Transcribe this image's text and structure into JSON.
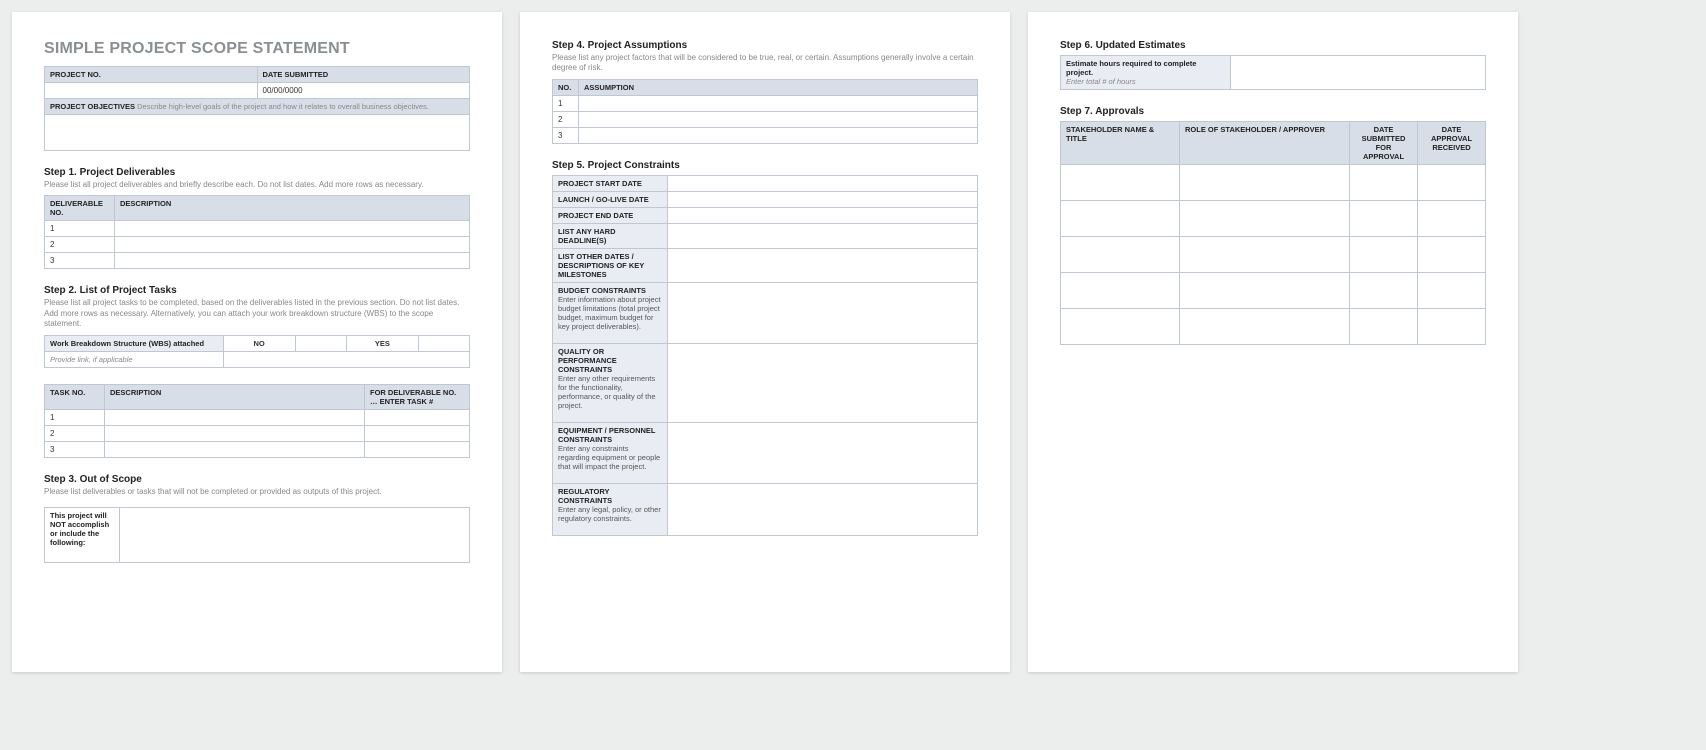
{
  "doc_title": "SIMPLE PROJECT SCOPE STATEMENT",
  "header_table": {
    "project_no_label": "PROJECT NO.",
    "date_submitted_label": "DATE SUBMITTED",
    "project_no_value": "",
    "date_submitted_value": "00/00/0000",
    "objectives_label": "PROJECT OBJECTIVES",
    "objectives_hint": "Describe high-level goals of the project and how it relates to overall business objectives.",
    "objectives_value": ""
  },
  "step1": {
    "title": "Step 1. Project Deliverables",
    "desc": "Please list all project deliverables and briefly describe each. Do not list dates. Add more rows as necessary.",
    "col_no": "DELIVERABLE NO.",
    "col_desc": "DESCRIPTION",
    "rows": [
      "1",
      "2",
      "3"
    ]
  },
  "step2": {
    "title": "Step 2. List of Project Tasks",
    "desc": "Please list all project tasks to be completed, based on the deliverables listed in the previous section. Do not list dates. Add more rows as necessary. Alternatively, you can attach your work breakdown structure (WBS) to the scope statement.",
    "wbs_label": "Work Breakdown Structure (WBS) attached",
    "no_label": "NO",
    "yes_label": "YES",
    "link_hint": "Provide link, if applicable",
    "col_task": "TASK NO.",
    "col_desc": "DESCRIPTION",
    "col_for": "FOR DELIVERABLE NO. … ENTER TASK #",
    "rows": [
      "1",
      "2",
      "3"
    ]
  },
  "step3": {
    "title": "Step 3. Out of Scope",
    "desc": "Please list deliverables or tasks that will not be completed or provided as outputs of this project.",
    "label_prefix": "This project ",
    "label_bold": "will NOT accomplish or include",
    "label_suffix": " the following:"
  },
  "step4": {
    "title": "Step 4. Project Assumptions",
    "desc": "Please list any project factors that will be considered to be true, real, or certain. Assumptions generally involve a certain degree of risk.",
    "col_no": "NO.",
    "col_assumption": "ASSUMPTION",
    "rows": [
      "1",
      "2",
      "3"
    ]
  },
  "step5": {
    "title": "Step 5. Project Constraints",
    "rows": [
      {
        "label": "PROJECT START DATE",
        "hint": ""
      },
      {
        "label": "LAUNCH / GO-LIVE DATE",
        "hint": ""
      },
      {
        "label": "PROJECT END DATE",
        "hint": ""
      },
      {
        "label": "LIST ANY HARD DEADLINE(S)",
        "hint": ""
      },
      {
        "label": "LIST OTHER DATES / DESCRIPTIONS OF KEY MILESTONES",
        "hint": ""
      },
      {
        "label": "BUDGET CONSTRAINTS",
        "hint": "Enter information about project budget limitations (total project budget, maximum budget for key project deliverables)."
      },
      {
        "label": "QUALITY OR PERFORMANCE CONSTRAINTS",
        "hint": "Enter any other requirements for the functionality, performance, or quality of the project."
      },
      {
        "label": "EQUIPMENT / PERSONNEL CONSTRAINTS",
        "hint": "Enter any constraints regarding equipment or people that will impact the project."
      },
      {
        "label": "REGULATORY CONSTRAINTS",
        "hint": "Enter any legal, policy, or other regulatory constraints."
      }
    ]
  },
  "step6": {
    "title": "Step 6. Updated Estimates",
    "label": "Estimate hours required to complete project.",
    "hint": "Enter total # of hours"
  },
  "step7": {
    "title": "Step 7. Approvals",
    "col_name": "STAKEHOLDER NAME & TITLE",
    "col_role": "ROLE OF STAKEHOLDER / APPROVER",
    "col_sub": "DATE SUBMITTED FOR APPROVAL",
    "col_rec": "DATE APPROVAL RECEIVED",
    "row_count": 5
  }
}
